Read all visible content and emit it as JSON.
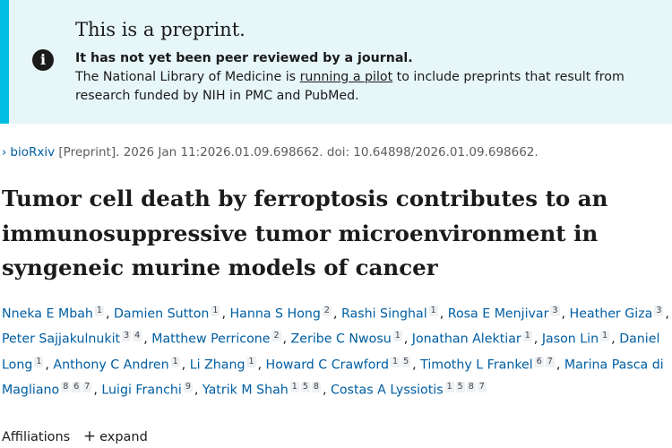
{
  "banner": {
    "title": "This is a preprint.",
    "bold_line": "It has not yet been peer reviewed by a journal.",
    "body_prefix": "The National Library of Medicine is ",
    "body_link": "running a pilot",
    "body_suffix": " to include preprints that result from research funded by NIH in PMC and PubMed.",
    "accent_color": "#00bde3",
    "background_color": "#e7f6f8",
    "icon": "info-icon"
  },
  "citation": {
    "source_link": "bioRxiv",
    "details": " [Preprint]. 2026 Jan 11:2026.01.09.698662. doi: 10.64898/2026.01.09.698662."
  },
  "article": {
    "title": "Tumor cell death by ferroptosis contributes to an immunosuppressive tumor microenvironment in syngeneic murine models of cancer"
  },
  "authors": [
    {
      "name": "Nneka E Mbah",
      "sups": [
        "1"
      ]
    },
    {
      "name": "Damien Sutton",
      "sups": [
        "1"
      ]
    },
    {
      "name": "Hanna S Hong",
      "sups": [
        "2"
      ]
    },
    {
      "name": "Rashi Singhal",
      "sups": [
        "1"
      ]
    },
    {
      "name": "Rosa E Menjivar",
      "sups": [
        "3"
      ]
    },
    {
      "name": "Heather Giza",
      "sups": [
        "3"
      ]
    },
    {
      "name": "Peter Sajjakulnukit",
      "sups": [
        "3",
        "4"
      ]
    },
    {
      "name": "Matthew Perricone",
      "sups": [
        "2"
      ]
    },
    {
      "name": "Zeribe C Nwosu",
      "sups": [
        "1"
      ]
    },
    {
      "name": "Jonathan Alektiar",
      "sups": [
        "1"
      ]
    },
    {
      "name": "Jason Lin",
      "sups": [
        "1"
      ]
    },
    {
      "name": "Daniel Long",
      "sups": [
        "1"
      ]
    },
    {
      "name": "Anthony C Andren",
      "sups": [
        "1"
      ]
    },
    {
      "name": "Li Zhang",
      "sups": [
        "1"
      ]
    },
    {
      "name": "Howard C Crawford",
      "sups": [
        "1",
        "5"
      ]
    },
    {
      "name": "Timothy L Frankel",
      "sups": [
        "6",
        "7"
      ]
    },
    {
      "name": "Marina Pasca di Magliano",
      "sups": [
        "8",
        "6",
        "7"
      ]
    },
    {
      "name": "Luigi Franchi",
      "sups": [
        "9"
      ]
    },
    {
      "name": "Yatrik M Shah",
      "sups": [
        "1",
        "5",
        "8"
      ]
    },
    {
      "name": "Costas A Lyssiotis",
      "sups": [
        "1",
        "5",
        "8",
        "7"
      ]
    }
  ],
  "affiliations": {
    "label": "Affiliations",
    "expand_label": "expand",
    "expand_icon": "plus-icon"
  }
}
